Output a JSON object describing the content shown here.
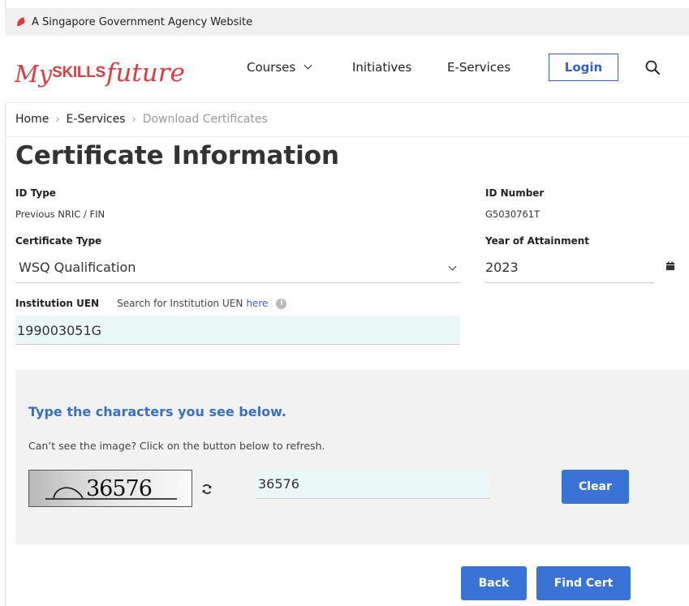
{
  "gov_bar": {
    "text": "A Singapore Government Agency Website",
    "icon": "lion-head-icon"
  },
  "logo": {
    "part1": "My",
    "part2": "SKILLS",
    "part3": "future"
  },
  "nav": {
    "courses": "Courses",
    "initiatives": "Initiatives",
    "eservices": "E-Services",
    "login": "Login"
  },
  "breadcrumb": {
    "home": "Home",
    "eservices": "E-Services",
    "current": "Download Certificates"
  },
  "page": {
    "title": "Certificate Information"
  },
  "form": {
    "id_type_label": "ID Type",
    "id_type_value": "Previous NRIC / FIN",
    "id_number_label": "ID Number",
    "id_number_value": "G5030761T",
    "cert_type_label": "Certificate Type",
    "cert_type_value": "WSQ Qualification",
    "year_label": "Year of Attainment",
    "year_value": "2023",
    "uen_label": "Institution UEN",
    "uen_hint": "Search for Institution UEN",
    "uen_link": "here",
    "uen_value": "199003051G"
  },
  "captcha": {
    "title": "Type the characters you see below.",
    "hint": "Can’t see the image? Click on the button below to refresh.",
    "image_text": "36576",
    "input_value": "36576",
    "clear": "Clear"
  },
  "actions": {
    "back": "Back",
    "find": "Find Cert"
  },
  "colors": {
    "brand_red": "#e03a3e",
    "primary_blue": "#3a73d6",
    "link_blue": "#3a5fcd",
    "input_bg": "#eaf7f7"
  }
}
